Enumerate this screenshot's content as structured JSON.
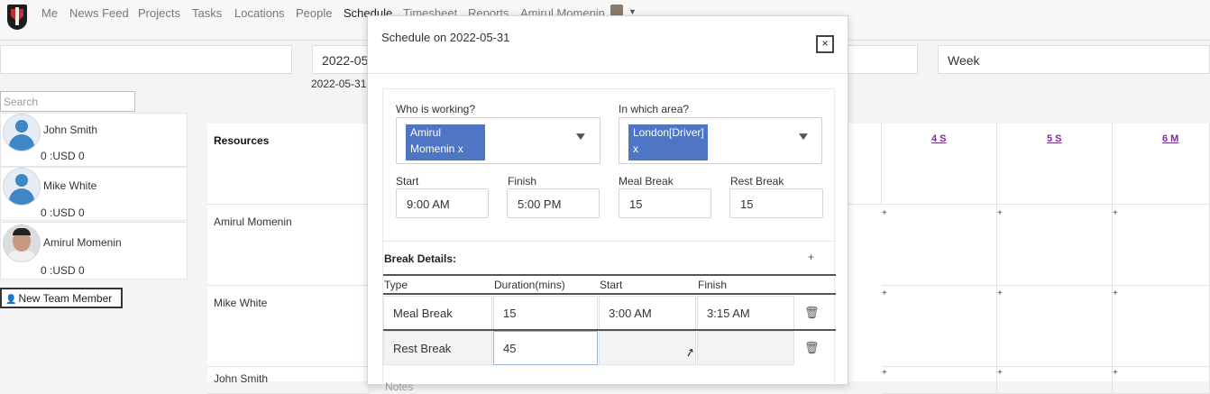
{
  "nav": {
    "items": [
      "Me",
      "News Feed",
      "Projects",
      "Tasks",
      "Locations",
      "People",
      "Schedule",
      "Timesheet",
      "Reports",
      "Amirul Momenin"
    ],
    "active": "Schedule"
  },
  "filters": {
    "date_value": "2022-05",
    "view_value": "Week",
    "date_label": "2022-05-31"
  },
  "sidebar": {
    "search_placeholder": "Search",
    "members": [
      {
        "name": "John Smith",
        "amount": "0 :USD 0"
      },
      {
        "name": "Mike White",
        "amount": "0 :USD 0"
      },
      {
        "name": "Amirul Momenin",
        "amount": "0 :USD 0"
      }
    ],
    "new_member_label": "New Team Member"
  },
  "grid": {
    "resources_header": "Resources",
    "day_headers": [
      "4 S",
      "5 S",
      "6 M"
    ],
    "rows": [
      "Amirul Momenin",
      "Mike White",
      "John Smith"
    ]
  },
  "modal": {
    "title": "Schedule on 2022-05-31",
    "close_label": "×",
    "who_label": "Who is working?",
    "who_chip": "Amirul Momenin x",
    "area_label": "In which area?",
    "area_chip": "London[Driver] x",
    "start_label": "Start",
    "start_value": "9:00 AM",
    "finish_label": "Finish",
    "finish_value": "5:00 PM",
    "meal_label": "Meal Break",
    "meal_value": "15",
    "rest_label": "Rest Break",
    "rest_value": "15",
    "break_details_label": "Break Details:",
    "add_label": "+",
    "columns": [
      "Type",
      "Duration(mins)",
      "Start",
      "Finish"
    ],
    "breaks": [
      {
        "type": "Meal Break",
        "duration": "15",
        "start": "3:00 AM",
        "finish": "3:15 AM"
      },
      {
        "type": "Rest Break",
        "duration": "45",
        "start": "",
        "finish": ""
      }
    ],
    "notes_label": "Notes"
  }
}
